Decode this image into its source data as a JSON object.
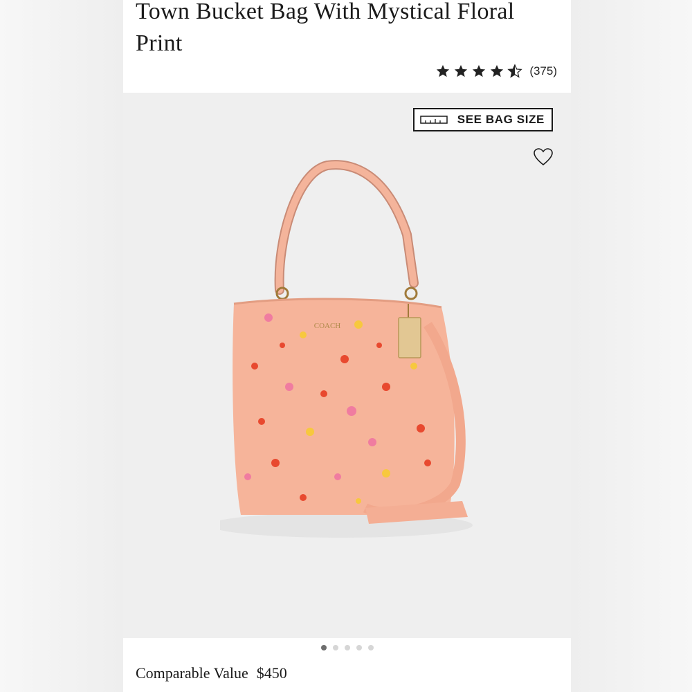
{
  "product": {
    "title": "Town Bucket Bag With Mystical Floral Print",
    "rating": 4.5,
    "review_count": "(375)"
  },
  "media": {
    "see_bag_size_label": "SEE BAG SIZE",
    "bag_color": "#f6b49a",
    "carousel_total": 5,
    "carousel_active": 1
  },
  "pricing": {
    "label": "Comparable Value",
    "value": "$450"
  },
  "icons": [
    "star-icon",
    "ruler-icon",
    "heart-icon"
  ]
}
